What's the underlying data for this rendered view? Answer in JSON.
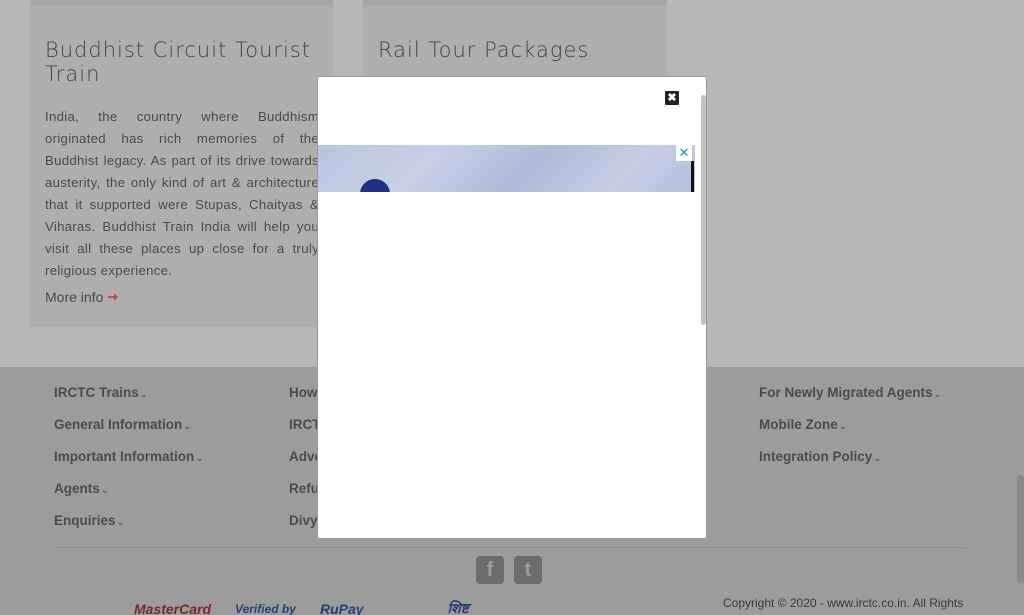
{
  "cards": [
    {
      "title": "Buddhist Circuit Tourist Train",
      "body": "India, the country where Buddhism originated has rich memories of the Buddhist legacy. As part of its drive towards austerity, the only kind of art & architecture that it supported were Stupas, Chaityas & Viharas. Buddhist Train India will help you visit all these places up close for a truly religious experience.",
      "more_label": "More info"
    },
    {
      "title": "Rail Tour Packages"
    }
  ],
  "footer": {
    "col1": [
      "IRCTC Trains",
      "General Information",
      "Important Information",
      "Agents",
      "Enquiries"
    ],
    "col2": [
      "How",
      "IRCT",
      "Adve",
      "Refu",
      "Divy"
    ],
    "col4": [
      "For Newly Migrated Agents",
      "Mobile Zone",
      "Integration Policy"
    ],
    "caret": "⌄",
    "social": [
      {
        "icon": "facebook-icon",
        "glyph": "f"
      },
      {
        "icon": "twitter-icon",
        "glyph": "t"
      }
    ],
    "partners": [
      "MasterCard",
      "Verified by",
      "RuPay",
      "शिष्ट"
    ],
    "copyright": "Copyright © 2020 - www.irctc.co.in. All Rights"
  },
  "modal": {
    "close_glyph": "✖",
    "ad_close_glyph": "✕"
  }
}
